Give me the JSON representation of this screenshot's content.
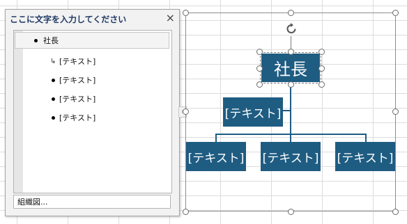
{
  "text_pane": {
    "title": "ここに文字を入力してください",
    "close_glyph": "×",
    "items": [
      {
        "label": "社長",
        "level": 1,
        "bullet": "dot"
      },
      {
        "label": "[テキスト]",
        "level": 2,
        "bullet": "arrow"
      },
      {
        "label": "[テキスト]",
        "level": 2,
        "bullet": "dot"
      },
      {
        "label": "[テキスト]",
        "level": 2,
        "bullet": "dot"
      },
      {
        "label": "[テキスト]",
        "level": 2,
        "bullet": "dot"
      }
    ],
    "footer_label": "組織図...",
    "toggle_glyph": "›"
  },
  "diagram": {
    "top_shape_label": "社長",
    "assistant_label": "[テキスト]",
    "child_labels": [
      "[テキスト]",
      "[テキスト]",
      "[テキスト]"
    ],
    "colors": {
      "shape_fill": "#1f5c82",
      "shape_text": "#ffffff",
      "selection_border": "#8c8c8c"
    }
  }
}
